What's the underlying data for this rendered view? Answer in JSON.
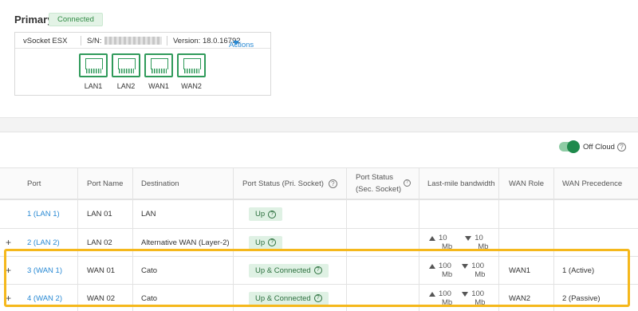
{
  "primary": {
    "title": "Primary",
    "status": "Connected"
  },
  "device": {
    "model": "vSocket ESX",
    "sn_label": "S/N:",
    "version": "Version: 18.0.16792",
    "actions_label": "Actions",
    "ports": [
      "LAN1",
      "LAN2",
      "WAN1",
      "WAN2"
    ]
  },
  "cloud": {
    "label": "Off Cloud",
    "toggle_on": true
  },
  "table": {
    "headers": {
      "port": "Port",
      "port_name": "Port Name",
      "destination": "Destination",
      "status_pri": "Port Status (Pri. Socket)",
      "status_sec_1": "Port Status",
      "status_sec_2": "(Sec. Socket)",
      "bandwidth": "Last-mile bandwidth",
      "wan_role": "WAN Role",
      "wan_precedence": "WAN Precedence"
    },
    "rows": [
      {
        "port": "1 (LAN 1)",
        "name": "LAN 01",
        "destination": "LAN",
        "status": "Up",
        "up": "",
        "down": "",
        "unit": "",
        "role": "",
        "precedence": ""
      },
      {
        "port": "2 (LAN 2)",
        "name": "LAN 02",
        "destination": "Alternative WAN (Layer-2)",
        "status": "Up",
        "up": "10",
        "down": "10",
        "unit": "Mb",
        "role": "",
        "precedence": ""
      },
      {
        "port": "3 (WAN 1)",
        "name": "WAN 01",
        "destination": "Cato",
        "status": "Up & Connected",
        "up": "100",
        "down": "100",
        "unit": "Mb",
        "role": "WAN1",
        "precedence": "1 (Active)"
      },
      {
        "port": "4 (WAN 2)",
        "name": "WAN 02",
        "destination": "Cato",
        "status": "Up & Connected",
        "up": "100",
        "down": "100",
        "unit": "Mb",
        "role": "WAN2",
        "precedence": "2 (Passive)"
      }
    ],
    "expand_symbol": "+"
  },
  "colors": {
    "accent": "#2a8ad4",
    "green": "#1f8a4c",
    "highlight": "#f5b81c"
  }
}
